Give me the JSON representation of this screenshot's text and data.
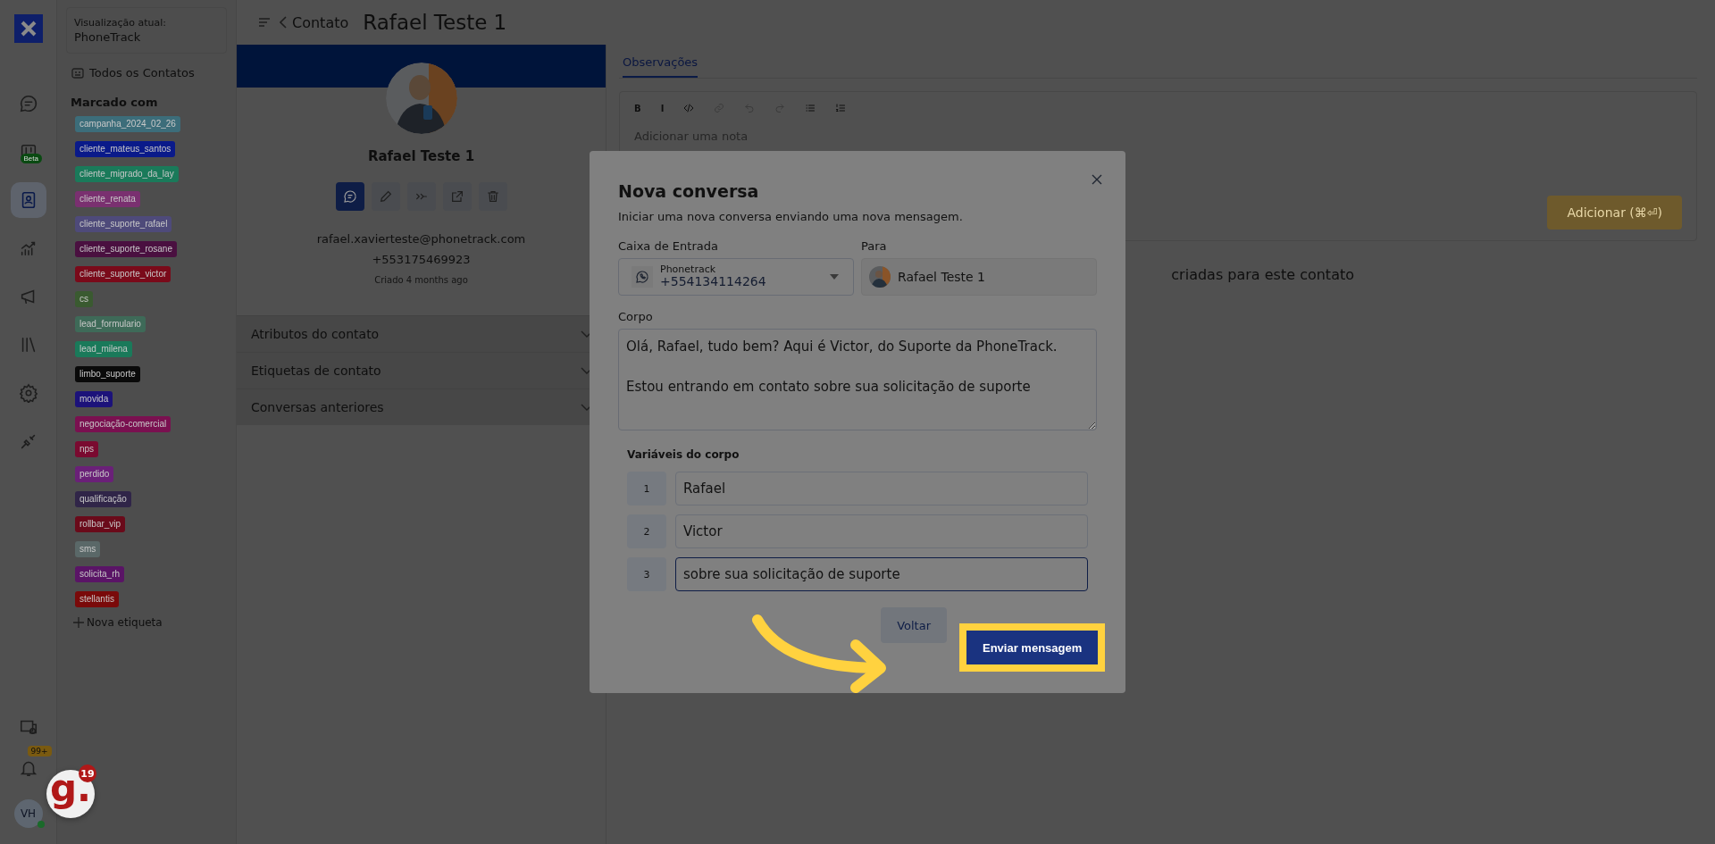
{
  "rail": {
    "items": [
      {
        "kind": "chat",
        "selected": false
      },
      {
        "kind": "board",
        "selected": false,
        "badge": "Beta"
      },
      {
        "kind": "contacts",
        "selected": true
      },
      {
        "kind": "reports",
        "selected": false
      },
      {
        "kind": "campaigns",
        "selected": false
      },
      {
        "kind": "library",
        "selected": false
      },
      {
        "kind": "settings",
        "selected": false
      },
      {
        "kind": "integrations",
        "selected": false
      }
    ],
    "notifications_badge": "99+",
    "user_initials": "VH",
    "user_online": true
  },
  "sidebar": {
    "view_label": "Visualização atual:",
    "view_name": "PhoneTrack",
    "all_contacts": "Todos os Contatos",
    "tags_heading": "Marcado com",
    "tags": [
      {
        "label": "campanha_2024_02_26",
        "color": "#3c6d7a"
      },
      {
        "label": "cliente_mateus_santos",
        "color": "#0a1a8a"
      },
      {
        "label": "cliente_migrado_da_lay",
        "color": "#1a7a5a"
      },
      {
        "label": "cliente_renata",
        "color": "#7a3070"
      },
      {
        "label": "cliente_suporte_rafael",
        "color": "#4e4a7a"
      },
      {
        "label": "cliente_suporte_rosane",
        "color": "#4a1040"
      },
      {
        "label": "cliente_suporte_victor",
        "color": "#7a0a1a"
      },
      {
        "label": "cs",
        "color": "#3a5a30"
      },
      {
        "label": "lead_formulario",
        "color": "#3e6a58"
      },
      {
        "label": "lead_milena",
        "color": "#1a7a5a"
      },
      {
        "label": "limbo_suporte",
        "color": "#0a0a0a"
      },
      {
        "label": "movida",
        "color": "#1c127a"
      },
      {
        "label": "negociação-comercial",
        "color": "#7a1050"
      },
      {
        "label": "nps",
        "color": "#7a0a30"
      },
      {
        "label": "perdido",
        "color": "#6a2078"
      },
      {
        "label": "qualificação",
        "color": "#302548"
      },
      {
        "label": "rollbar_vip",
        "color": "#6a0a1a"
      },
      {
        "label": "sms",
        "color": "#5a6868"
      },
      {
        "label": "solicita_rh",
        "color": "#5a1466"
      },
      {
        "label": "stellantis",
        "color": "#7a0a0a"
      }
    ],
    "new_tag": "Nova etiqueta"
  },
  "header": {
    "back": "Contato",
    "title": "Rafael Teste 1"
  },
  "contact": {
    "name": "Rafael Teste 1",
    "email": "rafael.xavierteste@phonetrack.com",
    "phone": "+553175469923",
    "created": "Criado 4 months ago",
    "actions": [
      {
        "kind": "message",
        "selected": true
      },
      {
        "kind": "edit",
        "selected": false
      },
      {
        "kind": "merge",
        "selected": false
      },
      {
        "kind": "open",
        "selected": false
      },
      {
        "kind": "delete",
        "selected": false
      }
    ],
    "sections": [
      {
        "label": "Atributos do contato"
      },
      {
        "label": "Etiquetas de contato"
      },
      {
        "label": "Conversas anteriores"
      }
    ]
  },
  "notes": {
    "tabs": [
      {
        "label": "Observações",
        "selected": true
      }
    ],
    "toolbar": [
      {
        "kind": "bold",
        "label": "B",
        "disabled": false
      },
      {
        "kind": "italic",
        "label": "I",
        "disabled": false
      },
      {
        "kind": "code",
        "disabled": false
      },
      {
        "kind": "link",
        "disabled": true
      },
      {
        "kind": "undo",
        "disabled": true
      },
      {
        "kind": "redo",
        "disabled": true
      },
      {
        "kind": "bullets",
        "disabled": false
      },
      {
        "kind": "numbers",
        "disabled": false
      }
    ],
    "placeholder": "Adicionar uma nota",
    "submit": "Adicionar (⌘⏎)",
    "empty_text": "criadas para este contato"
  },
  "modal": {
    "title": "Nova conversa",
    "subtitle": "Iniciar uma nova conversa enviando uma nova mensagem.",
    "inbox_label": "Caixa de Entrada",
    "inbox_name": "Phonetrack",
    "inbox_number": "+554134114264",
    "to_label": "Para",
    "to_name": "Rafael Teste 1",
    "body_label": "Corpo",
    "body": "Olá, Rafael, tudo bem? Aqui é Victor, do Suporte da PhoneTrack.\n\nEstou entrando em contato sobre sua solicitação de suporte",
    "variables_label": "Variáveis do corpo",
    "variables": [
      {
        "index": "1",
        "value": "Rafael",
        "focused": false
      },
      {
        "index": "2",
        "value": "Victor",
        "focused": false
      },
      {
        "index": "3",
        "value": "sobre sua solicitação de suporte",
        "focused": true
      }
    ],
    "cancel": "Voltar",
    "submit": "Enviar mensagem",
    "submit_highlighted": true
  },
  "widget": {
    "letter": "g.",
    "badge": "19"
  }
}
